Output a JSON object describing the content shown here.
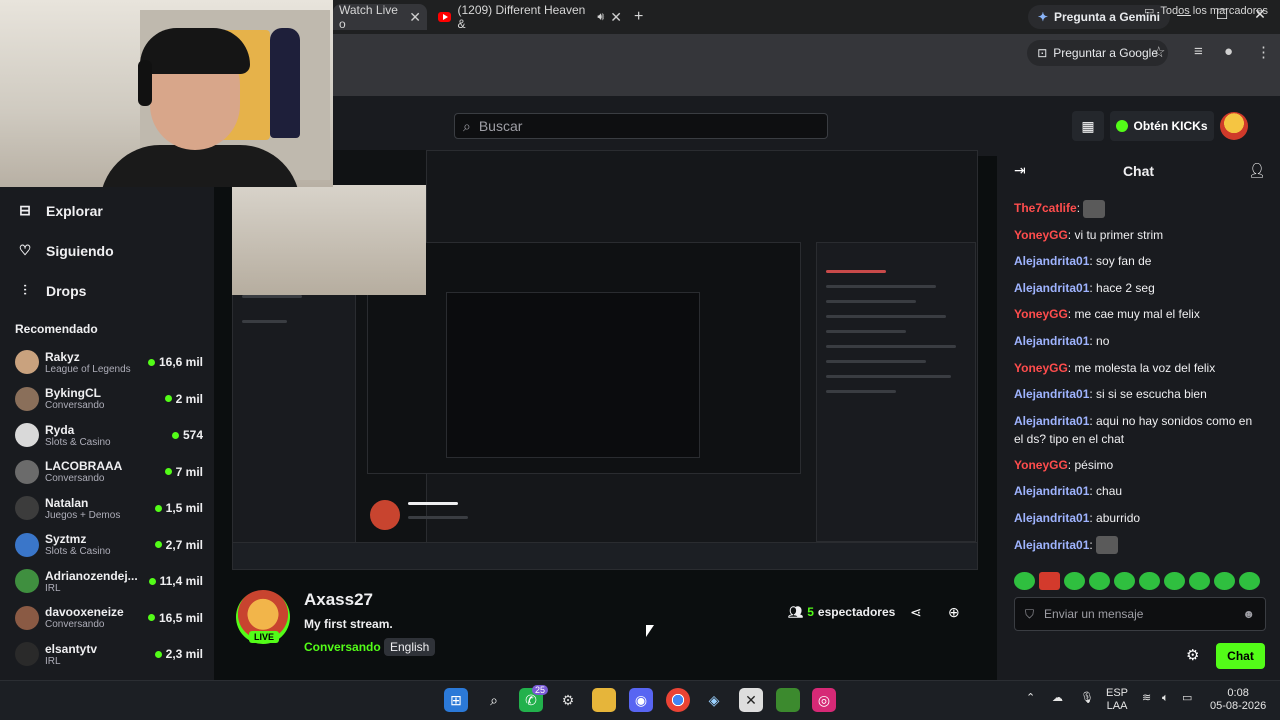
{
  "browser": {
    "tabs": [
      {
        "label": "Watch Live o",
        "close": "✕"
      },
      {
        "label": "(1209) Different Heaven &",
        "close": "✕"
      }
    ],
    "new_tab": "+",
    "gemini_label": "Pregunta a Gemini",
    "google_label": "Preguntar a Google",
    "bookmarks_label": "Todos los marcadores",
    "window_controls": {
      "min": "—",
      "max": "☐",
      "close": "✕"
    }
  },
  "topbar": {
    "search_placeholder": "Buscar",
    "kicks_label": "Obtén KICKs"
  },
  "sidebar": {
    "nav": [
      {
        "label": "Explorar",
        "icon": "compass-icon"
      },
      {
        "label": "Siguiendo",
        "icon": "heart-icon"
      },
      {
        "label": "Drops",
        "icon": "drops-icon"
      }
    ],
    "recommended_title": "Recomendado",
    "recommended": [
      {
        "name": "Rakyz",
        "category": "League of Legends",
        "viewers": "16,6 mil",
        "color": "#c9a27e"
      },
      {
        "name": "BykingCL",
        "category": "Conversando",
        "viewers": "2 mil",
        "color": "#8a6f5a"
      },
      {
        "name": "Ryda",
        "category": "Slots & Casino",
        "viewers": "574",
        "color": "#d9d9d9"
      },
      {
        "name": "LACOBRAAA",
        "category": "Conversando",
        "viewers": "7 mil",
        "color": "#6b6b6b"
      },
      {
        "name": "Natalan",
        "category": "Juegos + Demos",
        "viewers": "1,5 mil",
        "color": "#3c3c3c"
      },
      {
        "name": "Syztmz",
        "category": "Slots & Casino",
        "viewers": "2,7 mil",
        "color": "#3a76c9"
      },
      {
        "name": "Adrianozendej...",
        "category": "IRL",
        "viewers": "11,4 mil",
        "color": "#3f8f3f"
      },
      {
        "name": "davooxeneize",
        "category": "Conversando",
        "viewers": "16,5 mil",
        "color": "#8a5a44"
      },
      {
        "name": "elsantytv",
        "category": "IRL",
        "viewers": "2,3 mil",
        "color": "#2a2a2a"
      }
    ]
  },
  "stream": {
    "name": "Axass27",
    "title": "My first stream.",
    "category": "Conversando",
    "language": "English",
    "live_label": "LIVE",
    "viewers_count": "5",
    "viewers_label": "espectadores"
  },
  "chat": {
    "title": "Chat",
    "messages": [
      {
        "user": "The7catlife",
        "color": "#ff4d4d",
        "text": "",
        "emote": true
      },
      {
        "user": "YoneyGG",
        "color": "#ff4d4d",
        "text": "vi tu primer strim"
      },
      {
        "user": "Alejandrita01",
        "color": "#9fb4ff",
        "text": "soy fan de"
      },
      {
        "user": "Alejandrita01",
        "color": "#9fb4ff",
        "text": "hace 2 seg"
      },
      {
        "user": "YoneyGG",
        "color": "#ff4d4d",
        "text": "me cae muy mal el felix"
      },
      {
        "user": "Alejandrita01",
        "color": "#9fb4ff",
        "text": "no"
      },
      {
        "user": "YoneyGG",
        "color": "#ff4d4d",
        "text": "me molesta la voz del felix"
      },
      {
        "user": "Alejandrita01",
        "color": "#9fb4ff",
        "text": "si si se escucha bien"
      },
      {
        "user": "Alejandrita01",
        "color": "#9fb4ff",
        "text": "aqui no hay sonidos como en el ds? tipo en el chat"
      },
      {
        "user": "YoneyGG",
        "color": "#ff4d4d",
        "text": "pésimo"
      },
      {
        "user": "Alejandrita01",
        "color": "#9fb4ff",
        "text": "chau"
      },
      {
        "user": "Alejandrita01",
        "color": "#9fb4ff",
        "text": "aburrido"
      },
      {
        "user": "Alejandrita01",
        "color": "#9fb4ff",
        "text": "",
        "emote": true
      }
    ],
    "input_placeholder": "Enviar un mensaje",
    "send_label": "Chat"
  },
  "taskbar": {
    "lang_top": "ESP",
    "lang_bottom": "LAA",
    "time": "0:08",
    "date": "05-08-2026",
    "whatsapp_badge": "25"
  },
  "colors": {
    "accent": "#53fc18",
    "bg": "#0b0e0f",
    "panel": "#191b1f"
  }
}
